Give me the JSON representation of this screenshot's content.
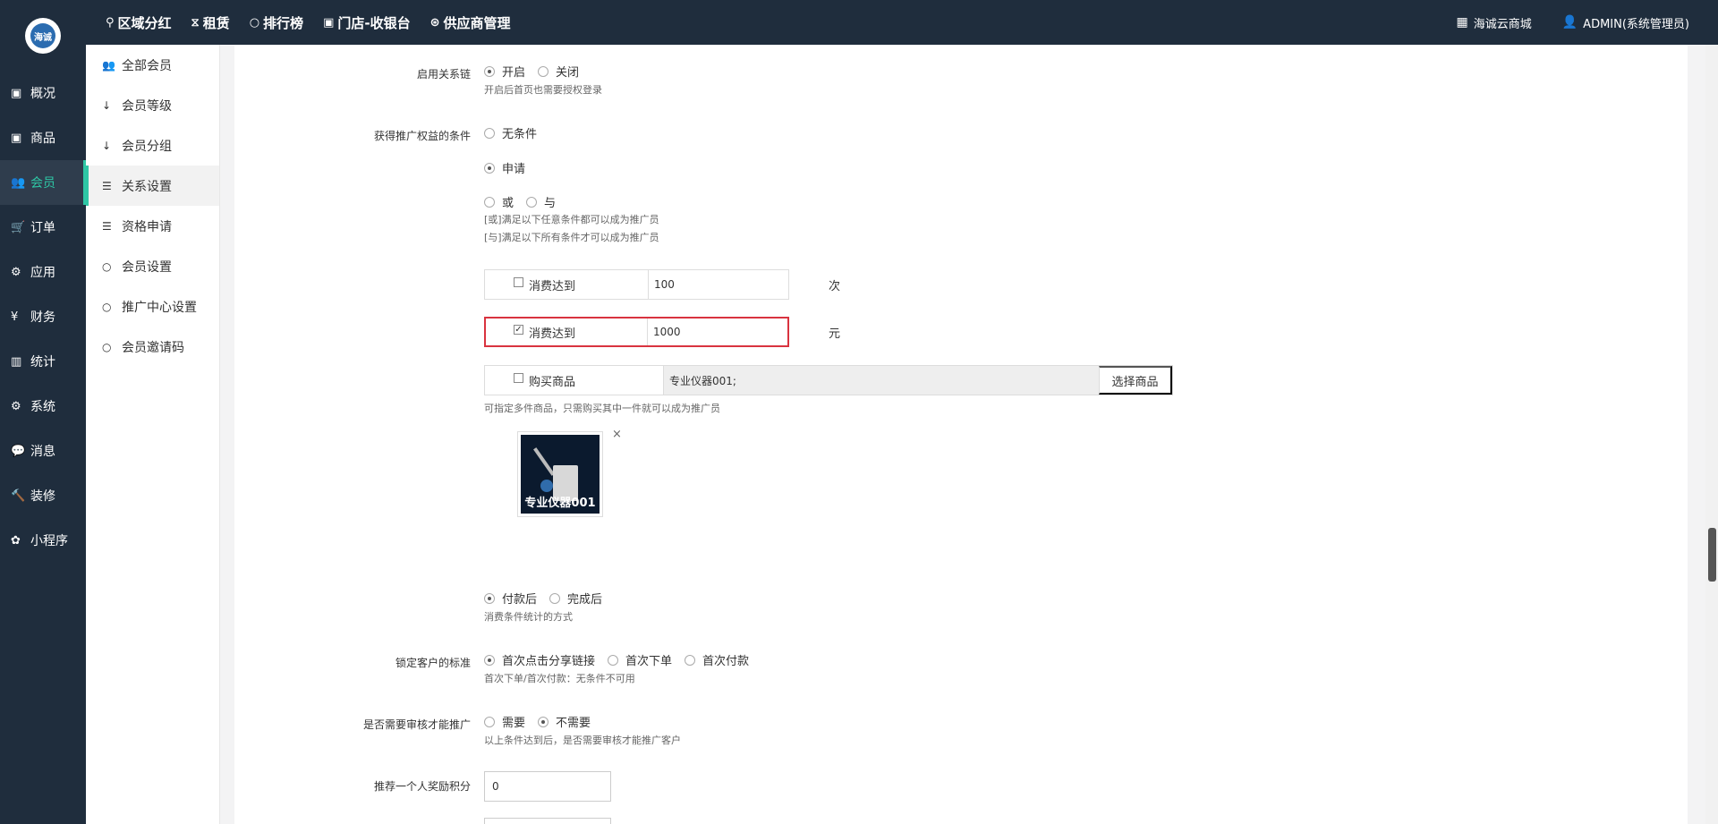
{
  "brand": {
    "logo_text": "海诚"
  },
  "topnav": [
    {
      "icon": "⚲",
      "label": "区域分红"
    },
    {
      "icon": "⧖",
      "label": "租赁"
    },
    {
      "icon": "○",
      "label": "排行榜"
    },
    {
      "icon": "▣",
      "label": "门店-收银台"
    },
    {
      "icon": "⊛",
      "label": "供应商管理"
    }
  ],
  "topright": {
    "shop_icon": "▦",
    "shop_label": "海诚云商城",
    "user_icon": "👤",
    "user_label": "ADMIN(系统管理员)"
  },
  "sidebar": [
    {
      "icon": "▣",
      "label": "概况"
    },
    {
      "icon": "▣",
      "label": "商品"
    },
    {
      "icon": "👥",
      "label": "会员"
    },
    {
      "icon": "🛒",
      "label": "订单"
    },
    {
      "icon": "⚙",
      "label": "应用"
    },
    {
      "icon": "¥",
      "label": "财务"
    },
    {
      "icon": "▥",
      "label": "统计"
    },
    {
      "icon": "⚙",
      "label": "系统"
    },
    {
      "icon": "💬",
      "label": "消息"
    },
    {
      "icon": "🔨",
      "label": "装修"
    },
    {
      "icon": "✿",
      "label": "小程序"
    }
  ],
  "subsidebar": [
    {
      "icon": "👥",
      "label": "全部会员"
    },
    {
      "icon": "↓",
      "label": "会员等级"
    },
    {
      "icon": "↓",
      "label": "会员分组"
    },
    {
      "icon": "☰",
      "label": "关系设置"
    },
    {
      "icon": "☰",
      "label": "资格申请"
    },
    {
      "icon": "○",
      "label": "会员设置"
    },
    {
      "icon": "○",
      "label": "推广中心设置"
    },
    {
      "icon": "○",
      "label": "会员邀请码"
    }
  ],
  "form": {
    "relation_chain": {
      "label": "启用关系链",
      "options": [
        "开启",
        "关闭"
      ],
      "help": "开启后首页也需要授权登录"
    },
    "promo_condition": {
      "label": "获得推广权益的条件",
      "opt_none": "无条件",
      "opt_apply": "申请",
      "opt_or": "或",
      "opt_and": "与",
      "help_or": "[或]满足以下任意条件都可以成为推广员",
      "help_and": "[与]满足以下所有条件才可以成为推广员"
    },
    "cond_times": {
      "label": "消费达到",
      "value": "100",
      "unit": "次"
    },
    "cond_amount": {
      "label": "消费达到",
      "value": "1000",
      "unit": "元",
      "check_mark": "✓"
    },
    "cond_goods": {
      "label": "购买商品",
      "value": "专业仪器001;",
      "button": "选择商品",
      "help": "可指定多件商品，只需购买其中一件就可以成为推广员"
    },
    "goods_item": {
      "caption": "专业仪器001",
      "close": "×"
    },
    "calc_method": {
      "options": [
        "付款后",
        "完成后"
      ],
      "help": "消费条件统计的方式"
    },
    "lock_standard": {
      "label": "锁定客户的标准",
      "options": [
        "首次点击分享链接",
        "首次下单",
        "首次付款"
      ],
      "help": "首次下单/首次付款：无条件不可用"
    },
    "need_review": {
      "label": "是否需要审核才能推广",
      "options": [
        "需要",
        "不需要"
      ],
      "help": "以上条件达到后，是否需要审核才能推广客户"
    },
    "reward_points": {
      "label": "推荐一个人奖励积分",
      "value": "0"
    }
  }
}
